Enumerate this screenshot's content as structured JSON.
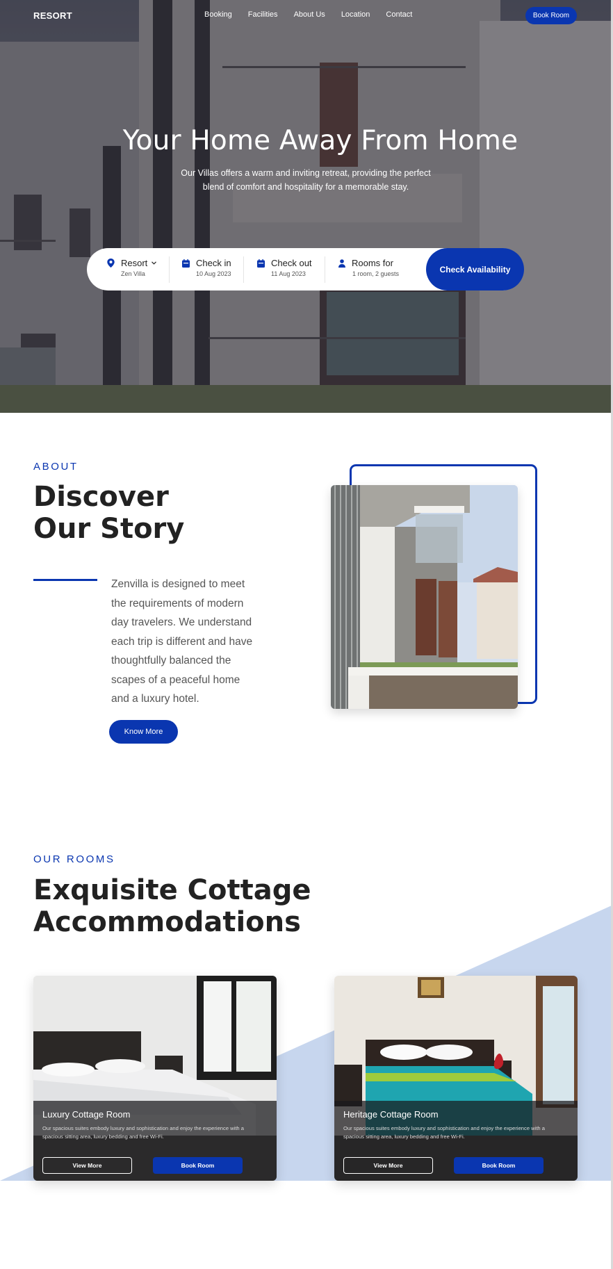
{
  "nav": {
    "logo": "RESORT",
    "links": [
      "Booking",
      "Facilities",
      "About Us",
      "Location",
      "Contact"
    ],
    "book_label": "Book Room"
  },
  "hero": {
    "title": "Your Home Away From Home",
    "subtitle": "Our Villas offers a warm and inviting retreat, providing the perfect blend of comfort and hospitality for a memorable stay."
  },
  "search": {
    "resort": {
      "label": "Resort",
      "value": "Zen Villa",
      "icon": "location-pin-icon"
    },
    "checkin": {
      "label": "Check in",
      "value": "10 Aug 2023",
      "icon": "calendar-icon"
    },
    "checkout": {
      "label": "Check out",
      "value": "11 Aug 2023",
      "icon": "calendar-icon"
    },
    "rooms": {
      "label": "Rooms for",
      "value": "1 room, 2 guests",
      "icon": "person-icon"
    },
    "submit_label": "Check Availability"
  },
  "about": {
    "tag": "ABOUT",
    "title_line1": "Discover",
    "title_line2": "Our Story",
    "text": "Zenvilla is designed to meet the requirements of modern day travelers. We understand each trip is different and have thoughtfully balanced the scapes of a peaceful home and a luxury hotel.",
    "button": "Know More"
  },
  "rooms": {
    "tag": "OUR ROOMS",
    "title_line1": "Exquisite Cottage",
    "title_line2": "Accommodations",
    "cards": [
      {
        "title": "Luxury Cottage Room",
        "description": "Our spacious suites embody luxury and sophistication and enjoy the experience with a spacious sitting area, luxury bedding and free Wi-Fi.",
        "view_label": "View More",
        "book_label": "Book Room"
      },
      {
        "title": "Heritage Cottage Room",
        "description": "Our spacious suites embody luxury and sophistication and enjoy the experience with a spacious sitting area, luxury bedding and free Wi-Fi.",
        "view_label": "View More",
        "book_label": "Book Room"
      }
    ]
  },
  "colors": {
    "accent": "#0a36b0",
    "rooms_band": "#c7d6ee"
  }
}
